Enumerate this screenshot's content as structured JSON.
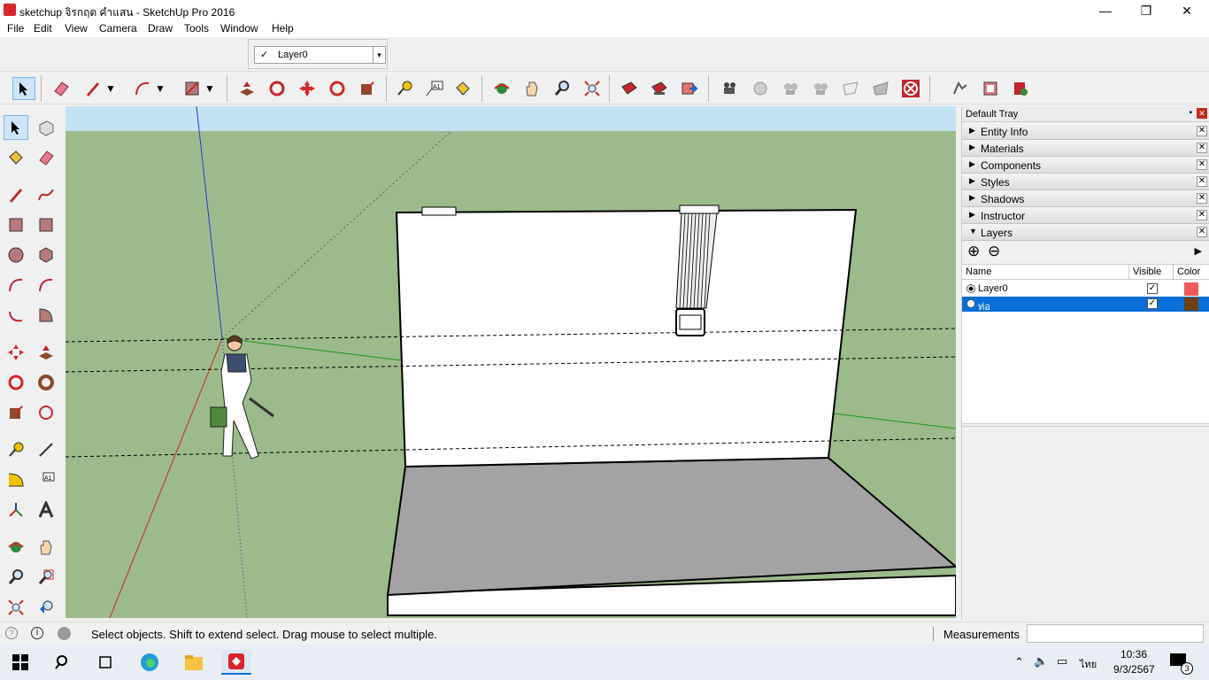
{
  "window": {
    "title": "sketchup จิรกฤต คำแสน - SketchUp Pro 2016",
    "minimize": "—",
    "maximize": "❐",
    "close": "✕"
  },
  "menu": [
    "File",
    "Edit",
    "View",
    "Camera",
    "Draw",
    "Tools",
    "Window",
    "Help"
  ],
  "layer_toolbar": {
    "checkmark": "✓",
    "current_layer": "Layer0",
    "dropdown": "▾"
  },
  "toolbar_icons": [
    "select-icon",
    "eraser-icon",
    "pencil-icon",
    "arc-icon",
    "rectangle-icon",
    "push-pull-icon",
    "follow-me-icon",
    "move-icon",
    "rotate-icon",
    "scale-icon",
    "tape-measure-icon",
    "text-icon",
    "paint-bucket-icon",
    "orbit-icon",
    "pan-icon",
    "zoom-icon",
    "zoom-extents-icon",
    "warehouse-icon",
    "components-icon",
    "send-icon",
    "camera-icon",
    "position-camera-icon",
    "look-around-icon",
    "walk-icon",
    "section-plane-icon",
    "section-display-icon",
    "delete-icon",
    "sandbox-icon",
    "layout-icon",
    "extension-icon"
  ],
  "colors": {
    "sky": "#c4e3f2",
    "ground": "#9cba8b",
    "selection": "#0a6fd8",
    "layer0_color": "#f15a5a",
    "layer2_color": "#6b4214",
    "floor": "#a3a3a3"
  },
  "tray": {
    "title": "Default Tray",
    "pin_icon": "📌",
    "close_icon": "✕",
    "panels": [
      {
        "name": "Entity Info",
        "expanded": false
      },
      {
        "name": "Materials",
        "expanded": false
      },
      {
        "name": "Components",
        "expanded": false
      },
      {
        "name": "Styles",
        "expanded": false
      },
      {
        "name": "Shadows",
        "expanded": false
      },
      {
        "name": "Instructor",
        "expanded": false
      },
      {
        "name": "Layers",
        "expanded": true
      }
    ],
    "collapsed_arrow": "▶",
    "expanded_arrow": "▼",
    "layers": {
      "add_icon": "⊕",
      "remove_icon": "⊖",
      "details_icon": "▶",
      "columns": {
        "name": "Name",
        "visible": "Visible",
        "color": "Color"
      },
      "rows": [
        {
          "name": "Layer0",
          "active": true,
          "visible": true,
          "selected": false
        },
        {
          "name": "ท่อ",
          "active": false,
          "visible": true,
          "selected": true
        }
      ]
    }
  },
  "status": {
    "message": "Select objects. Shift to extend select. Drag mouse to select multiple.",
    "measurements_label": "Measurements",
    "measurements_value": ""
  },
  "taskbar": {
    "time": "10:36",
    "date": "9/3/2567",
    "lang": "ไทย",
    "notifications": "3"
  }
}
